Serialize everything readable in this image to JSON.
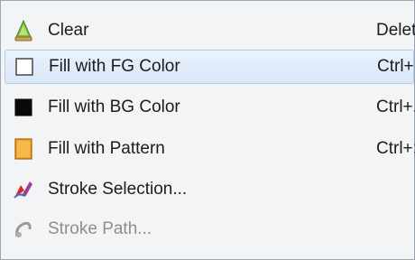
{
  "menu": {
    "items": [
      {
        "label": "Clear",
        "shortcut": "Delete",
        "icon": "clear-icon",
        "enabled": true,
        "hover": false
      },
      {
        "label": "Fill with FG Color",
        "shortcut": "Ctrl+,",
        "icon": "fg-color-swatch-icon",
        "enabled": true,
        "hover": true
      },
      {
        "label": "Fill with BG Color",
        "shortcut": "Ctrl+.",
        "icon": "bg-color-swatch-icon",
        "enabled": true,
        "hover": false
      },
      {
        "label": "Fill with Pattern",
        "shortcut": "Ctrl+;",
        "icon": "pattern-swatch-icon",
        "enabled": true,
        "hover": false
      },
      {
        "label": "Stroke Selection...",
        "shortcut": "",
        "icon": "stroke-selection-icon",
        "enabled": true,
        "hover": false
      },
      {
        "label": "Stroke Path...",
        "shortcut": "",
        "icon": "stroke-path-icon",
        "enabled": false,
        "hover": false
      }
    ]
  }
}
